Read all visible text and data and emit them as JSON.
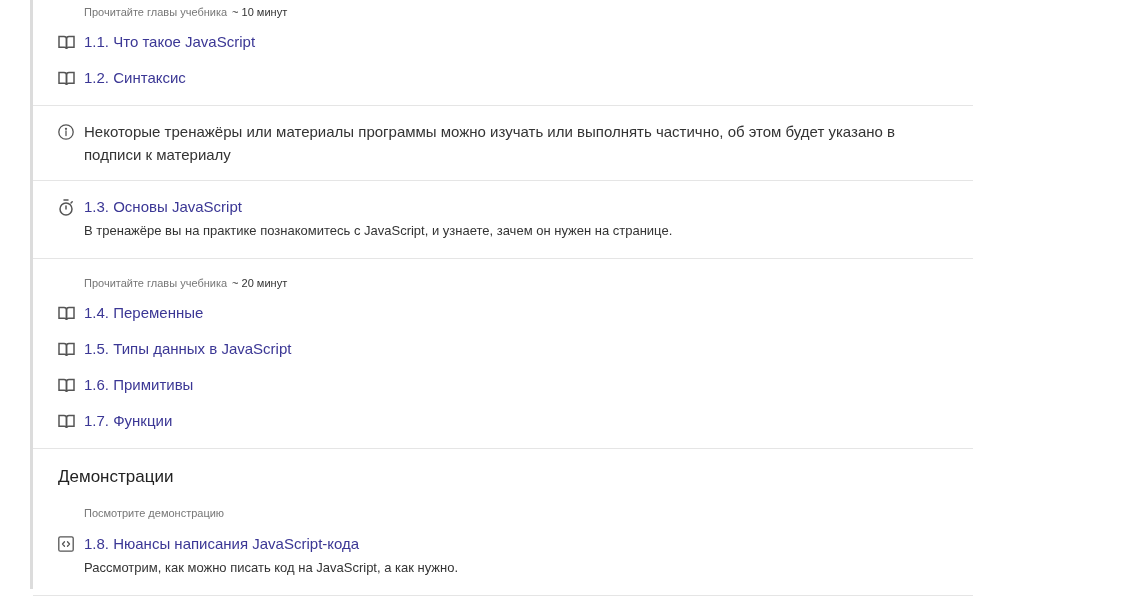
{
  "blocks": [
    {
      "kind": "group",
      "hint": "Прочитайте главы учебника",
      "duration": "~ 10 минут",
      "items": [
        {
          "kind": "chapter",
          "title": "1.1. Что такое JavaScript"
        },
        {
          "kind": "chapter",
          "title": "1.2. Синтаксис"
        }
      ]
    },
    {
      "kind": "note",
      "text": "Некоторые тренажёры или материалы программы можно изучать или выполнять частично, об этом будет указано в подписи к материалу"
    },
    {
      "kind": "group",
      "items": [
        {
          "kind": "trainer",
          "title": "1.3. Основы JavaScript",
          "description": "В тренажёре вы на практике познакомитесь с JavaScript, и узнаете, зачем он нужен на странице."
        }
      ]
    },
    {
      "kind": "group",
      "hint": "Прочитайте главы учебника",
      "duration": "~ 20 минут",
      "items": [
        {
          "kind": "chapter",
          "title": "1.4. Переменные"
        },
        {
          "kind": "chapter",
          "title": "1.5. Типы данных в JavaScript"
        },
        {
          "kind": "chapter",
          "title": "1.6. Примитивы"
        },
        {
          "kind": "chapter",
          "title": "1.7. Функции"
        }
      ]
    },
    {
      "kind": "group",
      "heading": "Демонстрации",
      "hint": "Посмотрите демонстрацию",
      "items": [
        {
          "kind": "demo",
          "title": "1.8. Нюансы написания JavaScript-кода",
          "description": "Рассмотрим, как можно писать код на JavaScript, а как нужно."
        }
      ]
    }
  ]
}
